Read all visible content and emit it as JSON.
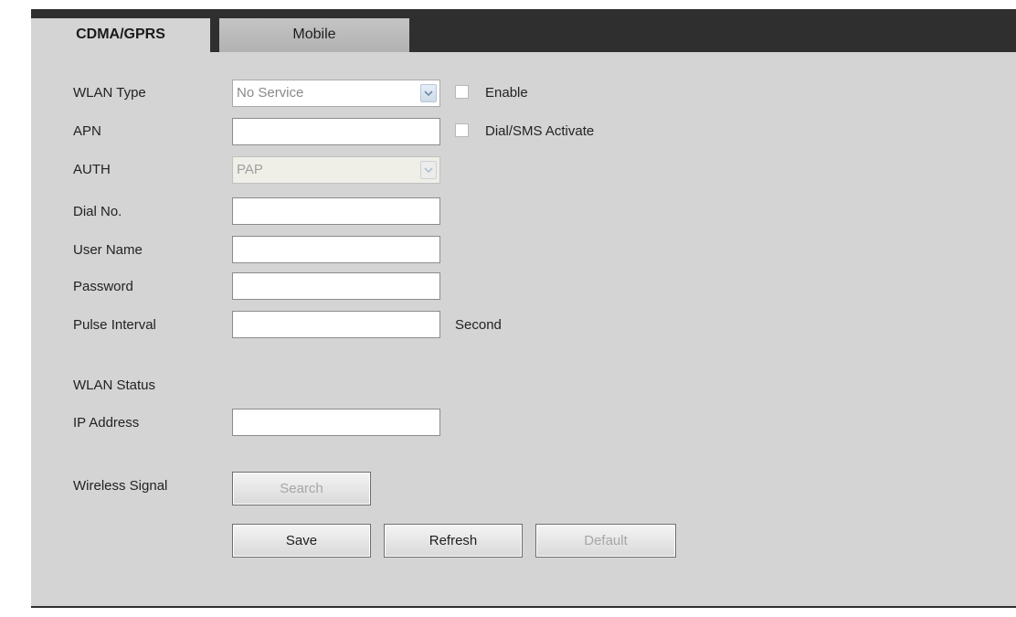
{
  "tabs": {
    "cdma_gprs": "CDMA/GPRS",
    "mobile": "Mobile"
  },
  "form": {
    "wlan_type": {
      "label": "WLAN Type",
      "selected": "No Service"
    },
    "enable": {
      "label": "Enable",
      "checked": false
    },
    "apn": {
      "label": "APN",
      "value": ""
    },
    "dial_sms": {
      "label": "Dial/SMS Activate",
      "checked": false
    },
    "auth": {
      "label": "AUTH",
      "selected": "PAP",
      "disabled": true
    },
    "dial_no": {
      "label": "Dial No.",
      "value": ""
    },
    "user_name": {
      "label": "User Name",
      "value": ""
    },
    "password": {
      "label": "Password",
      "value": ""
    },
    "pulse_interval": {
      "label": "Pulse Interval",
      "value": "",
      "unit": "Second"
    },
    "wlan_status": {
      "label": "WLAN Status"
    },
    "ip_address": {
      "label": "IP Address",
      "value": ""
    },
    "wireless_signal": {
      "label": "Wireless Signal"
    }
  },
  "buttons": {
    "search": "Search",
    "save": "Save",
    "refresh": "Refresh",
    "default": "Default"
  },
  "colors": {
    "frame": "#2f2f2f",
    "panel": "#d4d4d4",
    "tab_inactive": "#bcbcbc"
  },
  "icons": {
    "dropdown": "chevron-down-icon"
  }
}
